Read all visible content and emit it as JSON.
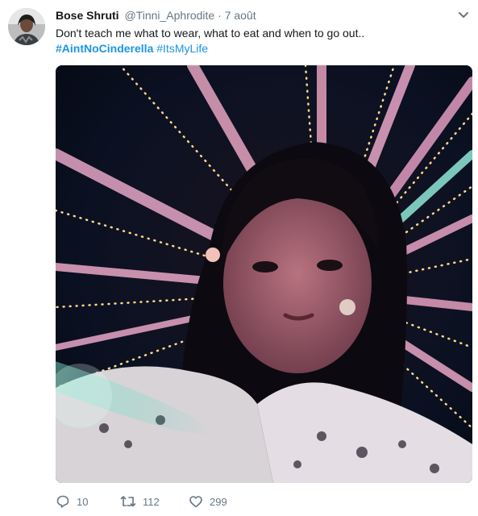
{
  "tweet": {
    "display_name": "Bose Shruti",
    "handle": "@Tinni_Aphrodite",
    "separator": "·",
    "timestamp": "7 août",
    "text": "Don't teach me what to wear, what to eat and when to go out..",
    "hashtags": [
      "#AintNoCinderella",
      "#ItsMyLife"
    ],
    "avatar_icon": "profile-avatar",
    "menu_icon": "chevron-down-icon",
    "media": "selfie photo with string lights"
  },
  "actions": {
    "replies": "10",
    "retweets": "112",
    "likes": "299"
  },
  "colors": {
    "link": "#1b95e0",
    "muted": "#657786",
    "text": "#14171a"
  }
}
